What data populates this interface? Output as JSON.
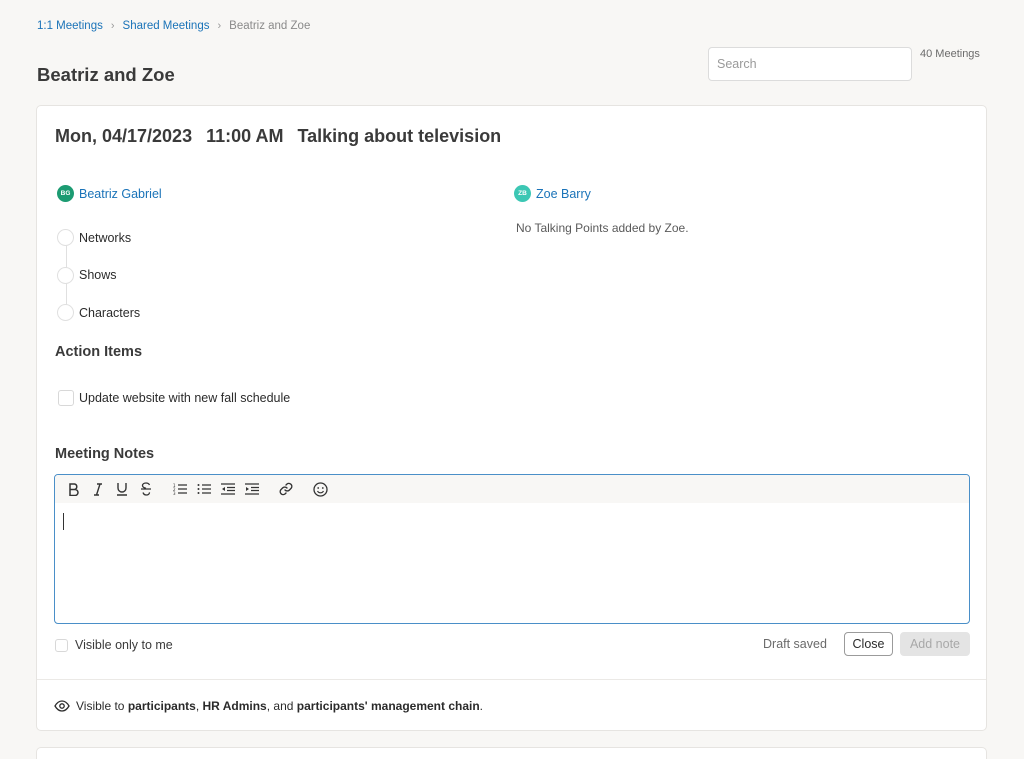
{
  "breadcrumb": {
    "item1": "1:1 Meetings",
    "item2": "Shared Meetings",
    "current": "Beatriz and Zoe"
  },
  "page": {
    "title": "Beatriz and Zoe",
    "meeting_count": "40 Meetings"
  },
  "search": {
    "placeholder": "Search"
  },
  "meeting": {
    "date": "Mon, 04/17/2023",
    "time": "11:00 AM",
    "title": "Talking about television"
  },
  "participants": [
    {
      "initials": "BG",
      "name": "Beatriz Gabriel",
      "color": "#1c9b72"
    },
    {
      "initials": "ZB",
      "name": "Zoe Barry",
      "color": "#3cc7b4"
    }
  ],
  "talking_points": [
    "Networks",
    "Shows",
    "Characters"
  ],
  "no_talking_points": "No Talking Points added by Zoe.",
  "action_items": {
    "title": "Action Items",
    "items": [
      "Update website with new fall schedule"
    ]
  },
  "notes": {
    "title": "Meeting Notes",
    "visible_only_me": "Visible only to me",
    "draft_status": "Draft saved",
    "close_label": "Close",
    "add_label": "Add note"
  },
  "visibility": {
    "prefix": "Visible to ",
    "participants": "participants",
    "sep1": ", ",
    "hr_admins": "HR Admins",
    "sep2": ", and ",
    "chain": "participants' management chain",
    "suffix": "."
  },
  "colors": {
    "link": "#1a73b8",
    "editor_border": "#4a8fc8"
  }
}
